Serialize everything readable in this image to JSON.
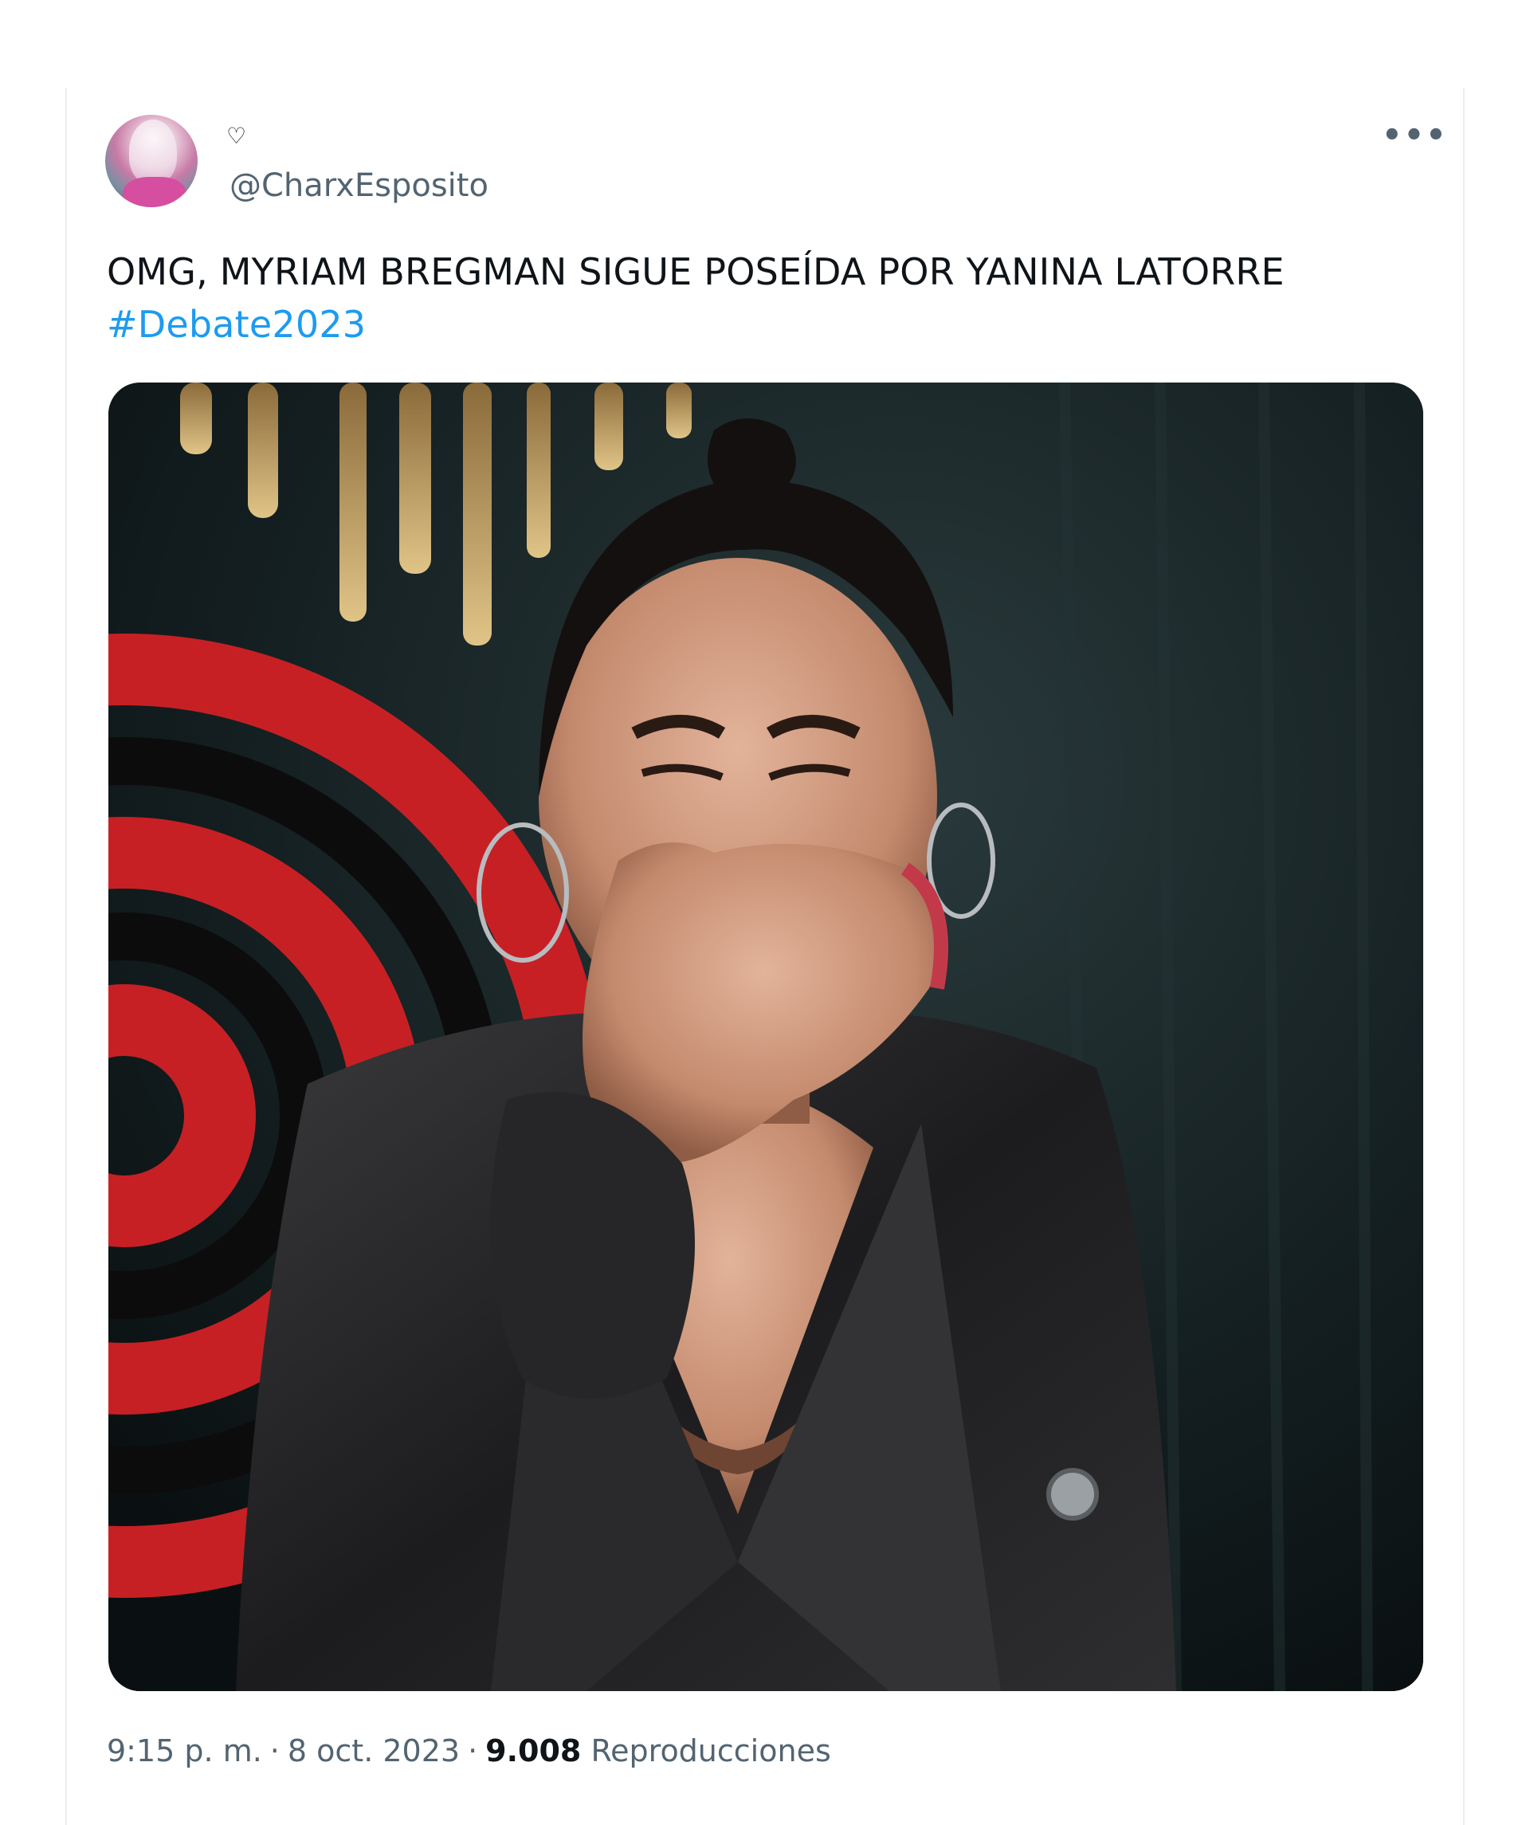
{
  "tweet": {
    "author_icon": "heart-outline-icon",
    "author_icon_glyph": "♡",
    "handle": "@CharxEsposito",
    "more_icon": "more-options-icon",
    "more_glyph": "•••",
    "text": "OMG, MYRIAM BREGMAN SIGUE POSEÍDA POR YANINA LATORRE",
    "hashtag": "#Debate2023",
    "time": "9:15 p. m.",
    "separator": "·",
    "date": "8 oct. 2023",
    "views_count": "9.008",
    "views_label": "Reproducciones"
  },
  "colors": {
    "link": "#1d9bf0",
    "secondary_text": "#536471",
    "primary_text": "#0f1419"
  }
}
